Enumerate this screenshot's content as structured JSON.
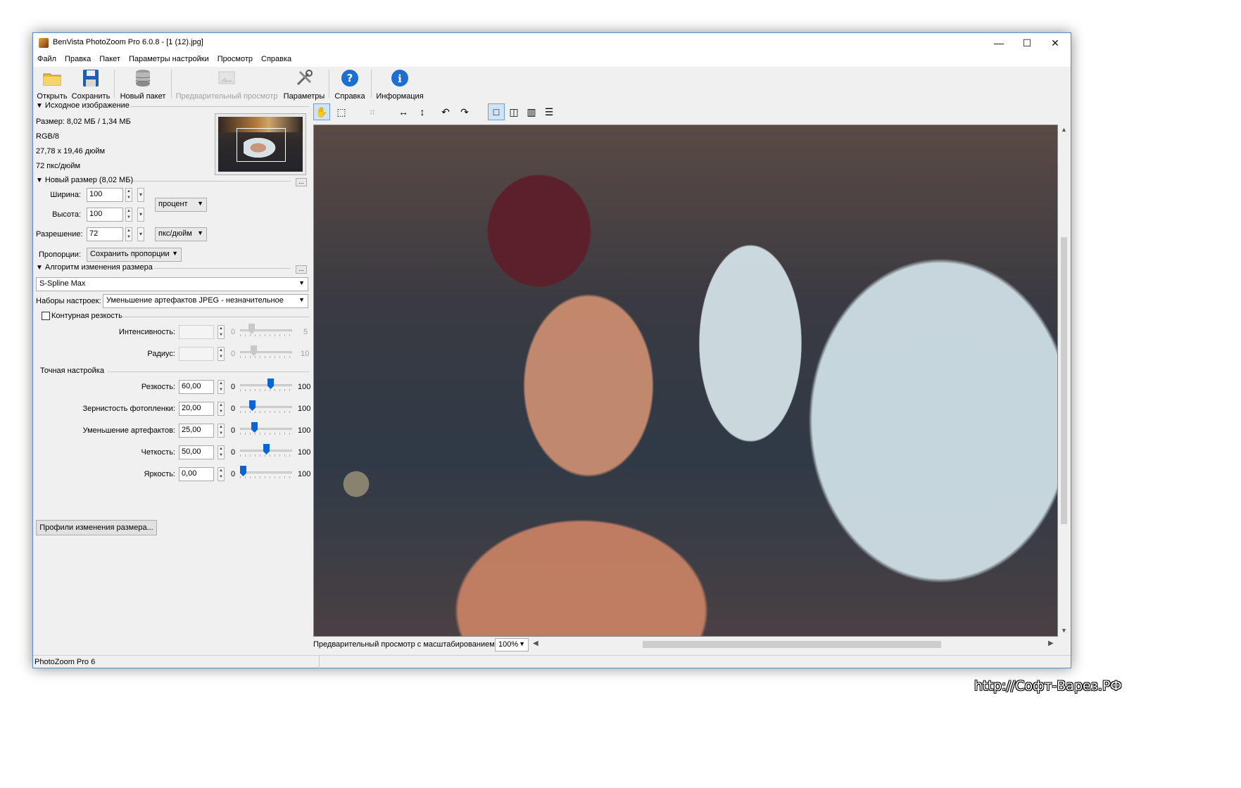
{
  "window": {
    "title": "BenVista PhotoZoom Pro 6.0.8 - [1 (12).jpg]",
    "minimize": "—",
    "maximize": "☐",
    "close": "✕"
  },
  "menu": [
    "Файл",
    "Правка",
    "Пакет",
    "Параметры настройки",
    "Просмотр",
    "Справка"
  ],
  "toolbar": {
    "open": "Открыть",
    "save": "Сохранить",
    "new_batch": "Новый пакет",
    "preview": "Предварительный просмотр",
    "settings": "Параметры",
    "help": "Справка",
    "info": "Информация"
  },
  "source": {
    "header": "Исходное изображение",
    "size": "Размер: 8,02 МБ / 1,34 МБ",
    "mode": "RGB/8",
    "dimensions": "27,78 x 19,46 дюйм",
    "resolution": "72 пкс/дюйм"
  },
  "new_size": {
    "header": "Новый размер (8,02 МБ)",
    "width_label": "Ширина:",
    "width_value": "100",
    "height_label": "Высота:",
    "height_value": "100",
    "resolution_label": "Разрешение:",
    "resolution_value": "72",
    "unit": "процент",
    "res_unit": "пкс/дюйм",
    "proportions_label": "Пропорции:",
    "proportions_value": "Сохранить пропорции",
    "more": "..."
  },
  "algorithm": {
    "header": "Алгоритм изменения размера",
    "method": "S-Spline Max",
    "preset_label": "Наборы настроек:",
    "preset_value": "Уменьшение артефактов JPEG - незначительное",
    "more": "..."
  },
  "unsharp": {
    "checkbox_label": "Контурная резкость",
    "intensity_label": "Интенсивность:",
    "intensity_min": "0",
    "intensity_max": "5",
    "radius_label": "Радиус:",
    "radius_min": "0",
    "radius_max": "10"
  },
  "fine_tuning": {
    "header": "Точная настройка",
    "rows": [
      {
        "label": "Резкость:",
        "value": "60,00",
        "min": "0",
        "max": "100",
        "level": 60
      },
      {
        "label": "Зернистость фотопленки:",
        "value": "20,00",
        "min": "0",
        "max": "100",
        "level": 20
      },
      {
        "label": "Уменьшение артефактов:",
        "value": "25,00",
        "min": "0",
        "max": "100",
        "level": 25
      },
      {
        "label": "Четкость:",
        "value": "50,00",
        "min": "0",
        "max": "100",
        "level": 50
      },
      {
        "label": "Яркость:",
        "value": "0,00",
        "min": "0",
        "max": "100",
        "level": 0
      }
    ],
    "profiles_button": "Профили изменения размера..."
  },
  "preview": {
    "zoom_label": "Предварительный просмотр с масштабированием:",
    "zoom_value": "100%"
  },
  "status": {
    "text": "PhotoZoom Pro 6"
  },
  "watermark": "http://Софт-Варез.РФ",
  "colors": {
    "accent": "#0a64d2",
    "window_border": "#5a8dc7"
  }
}
